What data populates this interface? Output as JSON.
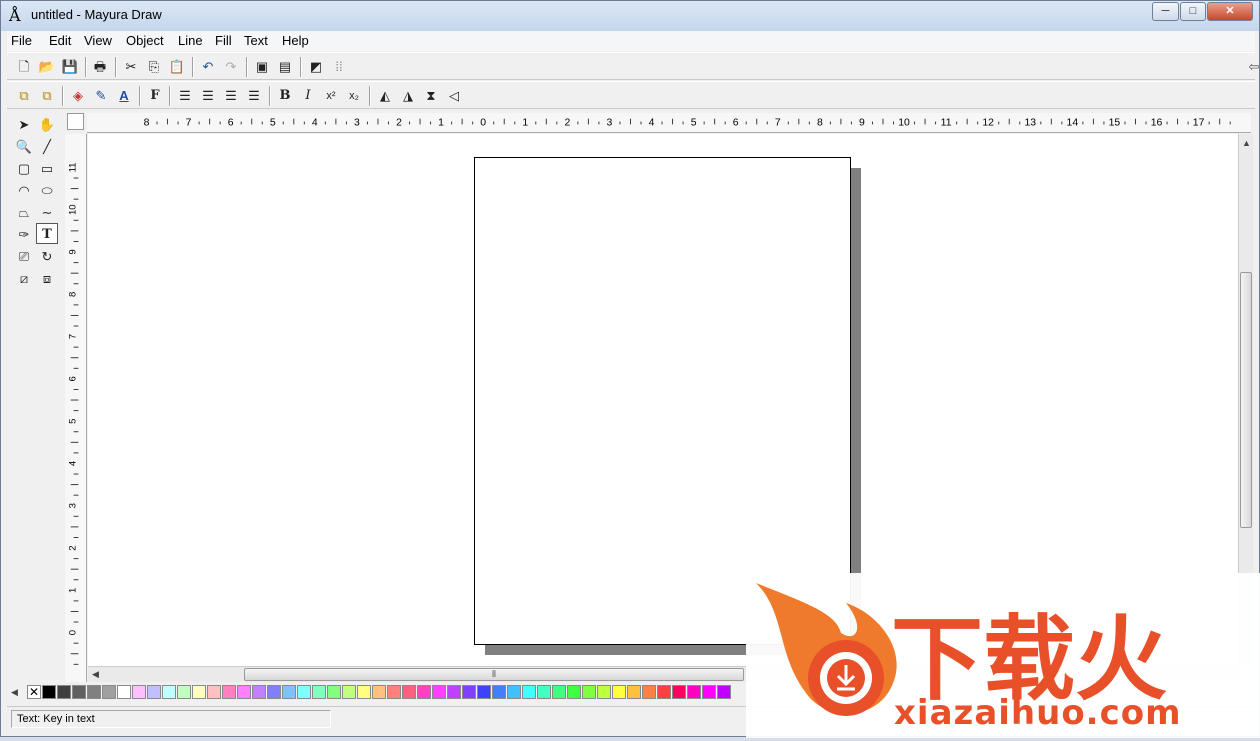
{
  "window": {
    "title": "untitled - Mayura Draw",
    "buttons": {
      "minimize": "─",
      "maximize": "□",
      "close": "✕"
    }
  },
  "menubar": {
    "items": [
      "File",
      "Edit",
      "View",
      "Object",
      "Line",
      "Fill",
      "Text",
      "Help"
    ]
  },
  "toolbar1": {
    "icons": [
      "new-icon",
      "open-icon",
      "save-icon",
      "print-icon",
      "cut-icon",
      "copy-icon",
      "paste-icon",
      "undo-icon",
      "redo-icon",
      "page-icon",
      "page-setup-icon",
      "gradient-icon",
      "grid-icon"
    ]
  },
  "toolbar2": {
    "bold": "B",
    "italic": "I",
    "font": "F",
    "superscript": "x²",
    "subscript": "x₂"
  },
  "ruler": {
    "horizontal": [
      "8",
      "7",
      "6",
      "5",
      "4",
      "3",
      "2",
      "1",
      "0",
      "1",
      "2",
      "3",
      "4",
      "5",
      "6",
      "7",
      "8",
      "9",
      "10",
      "11",
      "12",
      "13",
      "14",
      "15",
      "16",
      "17"
    ],
    "vertical": [
      "11",
      "10",
      "9",
      "8",
      "7",
      "6",
      "5",
      "4",
      "3",
      "2",
      "1",
      "0"
    ]
  },
  "toolbox": {
    "tools": [
      "select-tool",
      "hand-tool",
      "zoom-tool",
      "line-tool",
      "rounded-rect-tool",
      "rect-tool",
      "arc-tool",
      "ellipse-tool",
      "polygon-tool",
      "curve-tool",
      "eyedropper-tool",
      "text-tool",
      "image-tool",
      "rotate-tool",
      "skew-tool",
      "scale-tool"
    ],
    "text_tool_label": "T"
  },
  "palette": {
    "colors": [
      "#000000",
      "#404040",
      "#606060",
      "#808080",
      "#a0a0a0",
      "#ffffff",
      "#ffc0ff",
      "#c0c0ff",
      "#c0ffff",
      "#c0ffc0",
      "#ffffc0",
      "#ffc0c0",
      "#ff80c0",
      "#ff80ff",
      "#c080ff",
      "#8080ff",
      "#80c0ff",
      "#80ffff",
      "#80ffc0",
      "#80ff80",
      "#c0ff80",
      "#ffff80",
      "#ffc080",
      "#ff8080",
      "#ff6080",
      "#ff40c0",
      "#ff40ff",
      "#c040ff",
      "#8040ff",
      "#4040ff",
      "#4080ff",
      "#40c0ff",
      "#40ffff",
      "#40ffc0",
      "#40ff80",
      "#40ff40",
      "#80ff40",
      "#c0ff40",
      "#ffff40",
      "#ffc040",
      "#ff8040",
      "#ff4040",
      "#ff0060",
      "#ff00c0",
      "#ff00ff",
      "#c000ff"
    ]
  },
  "status": {
    "text": "Text: Key in text"
  },
  "watermark": {
    "cn": "下载火",
    "url": "xiazaihuo.com"
  }
}
